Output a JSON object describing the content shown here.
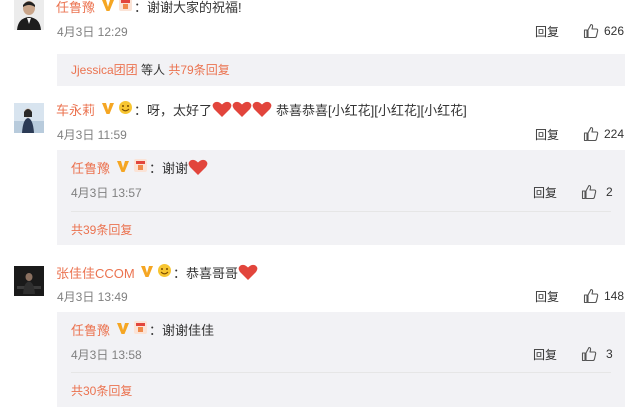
{
  "colors": {
    "accent": "#eb7350",
    "muted": "#808080",
    "panel": "#f2f2f5",
    "heart": "#e2453c"
  },
  "comments": [
    {
      "name": "任鲁豫",
      "text": "：谢谢大家的祝福!",
      "time": "4月3日 12:29",
      "reply": "回复",
      "likes": "626",
      "summary_user": "Jjessica团团",
      "summary_mid": " 等人 ",
      "summary_count": "共79条回复"
    },
    {
      "name": "车永莉",
      "text_a": "：呀，太好了",
      "text_b": "恭喜恭喜[小红花][小红花][小红花]",
      "time": "4月3日 11:59",
      "reply": "回复",
      "likes": "224",
      "sub": {
        "name": "任鲁豫",
        "text": "：谢谢",
        "time": "4月3日 13:57",
        "reply": "回复",
        "likes": "2"
      },
      "more": "共39条回复"
    },
    {
      "name": "张佳佳CCOM",
      "text": "：恭喜哥哥",
      "time": "4月3日 13:49",
      "reply": "回复",
      "likes": "148",
      "sub": {
        "name": "任鲁豫",
        "text": "：谢谢佳佳",
        "time": "4月3日 13:58",
        "reply": "回复",
        "likes": "3"
      },
      "more": "共30条回复"
    }
  ]
}
